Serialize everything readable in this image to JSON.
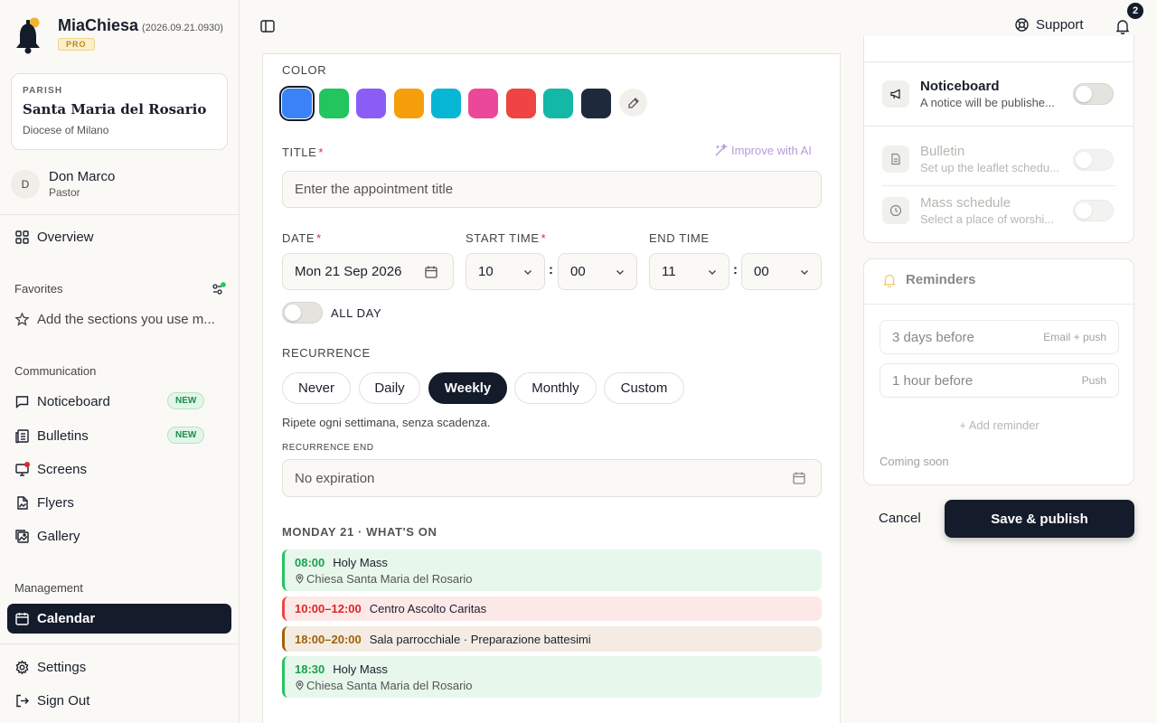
{
  "app": {
    "name": "MiaChiesa",
    "version": "(2026.09.21.0930)",
    "plan": "PRO"
  },
  "parish": {
    "label": "PARISH",
    "name": "Santa Maria del Rosario",
    "diocese": "Diocese of Milano"
  },
  "user": {
    "initial": "D",
    "name": "Don Marco",
    "role": "Pastor"
  },
  "nav": {
    "overview": "Overview",
    "favorites_title": "Favorites",
    "favorites_hint": "Add the sections you use m...",
    "communication_title": "Communication",
    "noticeboard": "Noticeboard",
    "bulletins": "Bulletins",
    "screens": "Screens",
    "flyers": "Flyers",
    "gallery": "Gallery",
    "management_title": "Management",
    "calendar": "Calendar",
    "settings": "Settings",
    "sign_out": "Sign Out",
    "new_badge": "NEW"
  },
  "topbar": {
    "support": "Support",
    "notifications": "2"
  },
  "form": {
    "color_label": "COLOR",
    "colors": [
      "#3b82f6",
      "#22c55e",
      "#8b5cf6",
      "#f59e0b",
      "#06b6d4",
      "#ec4899",
      "#ef4444",
      "#14b8a6",
      "#1e293b"
    ],
    "title_label": "TITLE",
    "required_mark": "*",
    "ai_button": "Improve with AI",
    "title_placeholder": "Enter the appointment title",
    "date_label": "DATE",
    "date_value": "Mon 21 Sep 2026",
    "start_label": "START TIME",
    "start_hour": "10",
    "start_min": "00",
    "end_label": "END TIME",
    "end_hour": "11",
    "end_min": "00",
    "time_sep": ":",
    "all_day": "ALL DAY",
    "recurrence_label": "RECURRENCE",
    "recurrence_options": [
      "Never",
      "Daily",
      "Weekly",
      "Monthly",
      "Custom"
    ],
    "recurrence_selected": "Weekly",
    "recurrence_help": "Ripete ogni settimana, senza scadenza.",
    "recurrence_end_label": "RECURRENCE END",
    "recurrence_end_value": "No expiration"
  },
  "schedule": {
    "title": "MONDAY 21 · WHAT'S ON",
    "events": [
      {
        "time": "08:00",
        "title": "Holy Mass",
        "place": "Chiesa Santa Maria del Rosario",
        "color": "#22c55e"
      },
      {
        "time": "10:00–12:00",
        "title": "Centro Ascolto Caritas",
        "place": "",
        "color": "#ef4444"
      },
      {
        "time": "18:00–20:00",
        "title": "Sala parrocchiale · Preparazione battesimi",
        "place": "",
        "color": "#a16207"
      },
      {
        "time": "18:30",
        "title": "Holy Mass",
        "place": "Chiesa Santa Maria del Rosario",
        "color": "#22c55e"
      }
    ]
  },
  "publish": {
    "noticeboard_title": "Noticeboard",
    "noticeboard_sub": "A notice will be publishe...",
    "bulletin_title": "Bulletin",
    "bulletin_sub": "Set up the leaflet schedu...",
    "mass_title": "Mass schedule",
    "mass_sub": "Select a place of worshi..."
  },
  "reminders": {
    "title": "Reminders",
    "items": [
      {
        "when": "3 days before",
        "channel": "Email + push"
      },
      {
        "when": "1 hour before",
        "channel": "Push"
      }
    ],
    "add": "+ Add reminder",
    "note": "Coming soon"
  },
  "actions": {
    "cancel": "Cancel",
    "save": "Save & publish"
  }
}
